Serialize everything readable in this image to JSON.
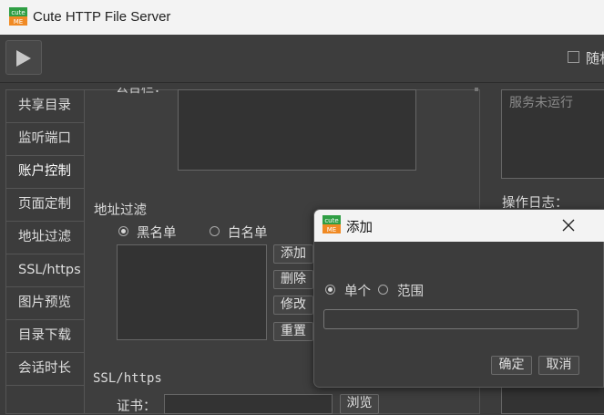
{
  "window": {
    "title": "Cute HTTP File Server",
    "logo_text_top": "cute",
    "logo_text_bottom": "ME"
  },
  "toolbar": {
    "play_icon": "play-icon",
    "random_label": "随机"
  },
  "sidebar": {
    "items": [
      {
        "label": "共享目录"
      },
      {
        "label": "监听端口"
      },
      {
        "label": "账户控制",
        "active": true
      },
      {
        "label": "页面定制"
      },
      {
        "label": "地址过滤"
      },
      {
        "label": "SSL/https"
      },
      {
        "label": "图片预览"
      },
      {
        "label": "目录下载"
      },
      {
        "label": "会话时长"
      }
    ]
  },
  "content": {
    "notice_label_partial": "公告栏：",
    "address_filter": {
      "title": "地址过滤",
      "blacklist_label": "黑名单",
      "whitelist_label": "白名单",
      "selected": "黑名单",
      "buttons": {
        "add": "添加",
        "delete": "删除",
        "modify": "修改",
        "reset": "重置"
      }
    },
    "ssl": {
      "title": "SSL/https",
      "cert_label": "证书：",
      "browse_label": "浏览"
    }
  },
  "right_panel": {
    "status_text": "服务未运行",
    "log_label": "操作日志："
  },
  "dialog": {
    "title": "添加",
    "single_label": "单个",
    "range_label": "范围",
    "selected": "单个",
    "input_value": "",
    "ok_label": "确定",
    "cancel_label": "取消"
  },
  "colors": {
    "logo_green": "#2f9e44",
    "logo_orange": "#f08a24",
    "background": "#3c3c3c"
  }
}
